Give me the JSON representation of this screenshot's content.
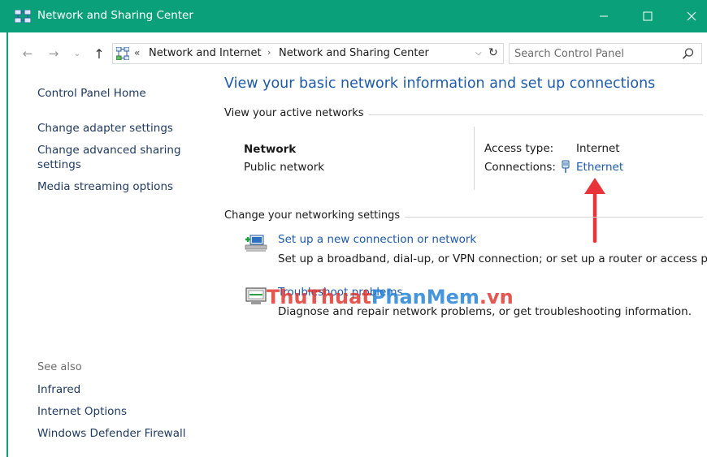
{
  "window": {
    "title": "Network and Sharing Center",
    "accent": "#0aa07a",
    "controls": {
      "minimize": "—",
      "maximize": "☐",
      "close": "✕"
    }
  },
  "address_bar": {
    "overflow_chevron": "«",
    "breadcrumbs": [
      "Network and Internet",
      "Network and Sharing Center"
    ],
    "separator": "›",
    "dropdown": "⌵",
    "refresh": "↻"
  },
  "nav": {
    "back": "←",
    "forward": "→",
    "recent": "⌄",
    "up": "↑"
  },
  "search": {
    "placeholder": "Search Control Panel"
  },
  "left_pane": {
    "home": "Control Panel Home",
    "links": [
      "Change adapter settings",
      "Change advanced sharing settings",
      "Media streaming options"
    ],
    "see_also_label": "See also",
    "see_also": [
      "Infrared",
      "Internet Options",
      "Windows Defender Firewall"
    ]
  },
  "main": {
    "title": "View your basic network information and set up connections",
    "active_networks_heading": "View your active networks",
    "network": {
      "name": "Network",
      "category": "Public network",
      "access_type_label": "Access type:",
      "access_type_value": "Internet",
      "connections_label": "Connections:",
      "connection_name": "Ethernet"
    },
    "settings_heading": "Change your networking settings",
    "tasks": [
      {
        "link": "Set up a new connection or network",
        "description": "Set up a broadband, dial-up, or VPN connection; or set up a router or access point."
      },
      {
        "link": "Troubleshoot problems",
        "description": "Diagnose and repair network problems, or get troubleshooting information."
      }
    ]
  },
  "watermark": {
    "part1": "ThuThuat",
    "part2": "PhanMem",
    "part3": ".vn"
  },
  "colors": {
    "link": "#1e5aa8",
    "arrow": "#e8333a",
    "watermark_red": "#e0312c",
    "watermark_blue": "#1e7fd6"
  }
}
